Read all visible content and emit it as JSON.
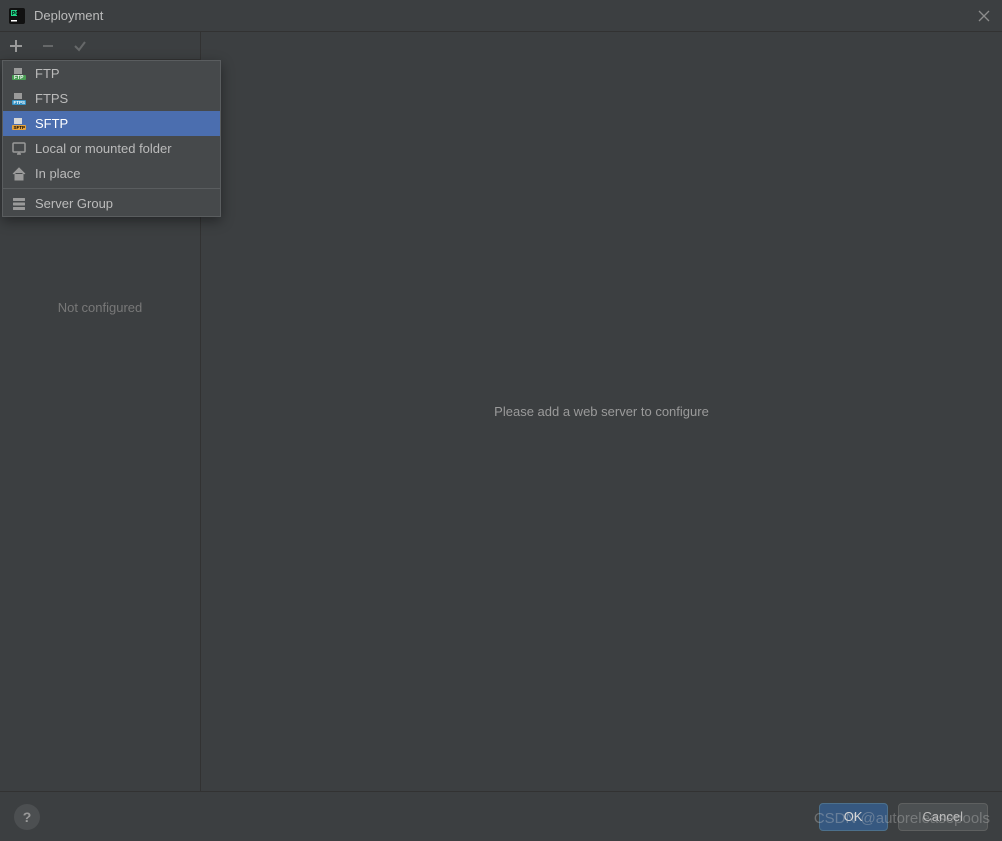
{
  "window": {
    "title": "Deployment"
  },
  "sidebar": {
    "placeholder": "Not configured"
  },
  "menu": {
    "items": [
      {
        "label": "FTP",
        "icon": "ftp-icon",
        "selected": false
      },
      {
        "label": "FTPS",
        "icon": "ftps-icon",
        "selected": false
      },
      {
        "label": "SFTP",
        "icon": "sftp-icon",
        "selected": true
      },
      {
        "label": "Local or mounted folder",
        "icon": "monitor-icon",
        "selected": false
      },
      {
        "label": "In place",
        "icon": "home-icon",
        "selected": false
      }
    ],
    "group_item": {
      "label": "Server Group",
      "icon": "server-group-icon"
    }
  },
  "main": {
    "empty_text": "Please add a web server to configure"
  },
  "footer": {
    "ok_label": "OK",
    "cancel_label": "Cancel"
  },
  "watermark": "CSDN @autoreleasepools"
}
